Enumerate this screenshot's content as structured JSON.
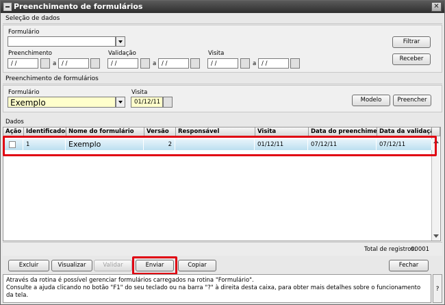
{
  "window": {
    "title": "Preenchimento de formulários",
    "close_label": "✕"
  },
  "selecao": {
    "section_title": "Seleção de dados",
    "formulario_label": "Formulário",
    "formulario_value": "",
    "preenchimento_label": "Preenchimento",
    "preenchimento_from": " / /",
    "preenchimento_to": " / /",
    "validacao_label": "Validação",
    "validacao_from": " / /",
    "validacao_to": " / /",
    "visita_label": "Visita",
    "visita_from": " / /",
    "visita_to": " / /",
    "a_label": "a",
    "filtrar_button": "Filtrar",
    "receber_button": "Receber"
  },
  "preench": {
    "section_title": "Preenchimento de formulários",
    "formulario_label": "Formulário",
    "formulario_value": "Exemplo",
    "visita_label": "Visita",
    "visita_value": "01/12/11",
    "modelo_button": "Modelo",
    "preencher_button": "Preencher"
  },
  "dados": {
    "section_title": "Dados",
    "columns": [
      "Ação",
      "Identificador",
      "Nome do formulário",
      "Versão",
      "Responsável",
      "Visita",
      "Data do preenchimento",
      "Data da validação"
    ],
    "rows": [
      {
        "acao": "",
        "identificador": "1",
        "nome": "Exemplo",
        "versao": "2",
        "responsavel": "",
        "visita": "01/12/11",
        "data_preenchimento": "07/12/11",
        "data_validacao": "07/12/11"
      }
    ],
    "total_label": "Total de registros:",
    "total_value": "00001"
  },
  "actions": {
    "excluir": "Excluir",
    "visualizar": "Visualizar",
    "validar": "Validar",
    "enviar": "Enviar",
    "copiar": "Copiar",
    "fechar": "Fechar"
  },
  "help": {
    "line1": "Através da rotina é possível gerenciar formulários carregados na rotina \"Formulário\".",
    "line2": "Consulte a ajuda clicando no botão \"F1\" do seu teclado ou na barra \"?\" à direita desta caixa, para obter mais detalhes sobre o funcionamento da tela.",
    "question": "?"
  },
  "colors": {
    "highlight": "#e00012",
    "row_fill": "#bcdff0",
    "required_field": "#ffffcc"
  }
}
